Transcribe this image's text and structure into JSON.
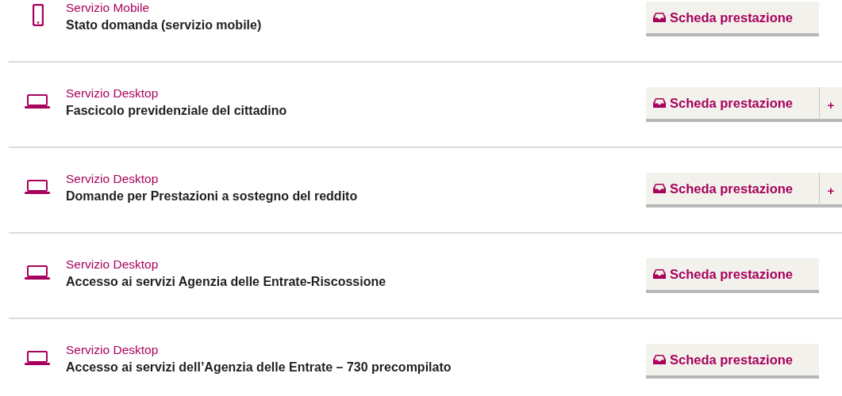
{
  "services": [
    {
      "kind": "mobile",
      "category": "Servizio Mobile",
      "title": "Stato domanda (servizio mobile)",
      "button": "Scheda prestazione"
    },
    {
      "kind": "desktop",
      "category": "Servizio Desktop",
      "title": "Fascicolo previdenziale del cittadino",
      "button": "Scheda prestazione",
      "more": "+"
    },
    {
      "kind": "desktop",
      "category": "Servizio Desktop",
      "title": "Domande per Prestazioni a sostegno del reddito",
      "button": "Scheda prestazione",
      "more": "+"
    },
    {
      "kind": "desktop",
      "category": "Servizio Desktop",
      "title": "Accesso ai servizi Agenzia delle Entrate-Riscossione",
      "button": "Scheda prestazione"
    },
    {
      "kind": "desktop",
      "category": "Servizio Desktop",
      "title": "Accesso ai servizi dell’Agenzia delle Entrate – 730 precompilato",
      "button": "Scheda prestazione"
    }
  ]
}
